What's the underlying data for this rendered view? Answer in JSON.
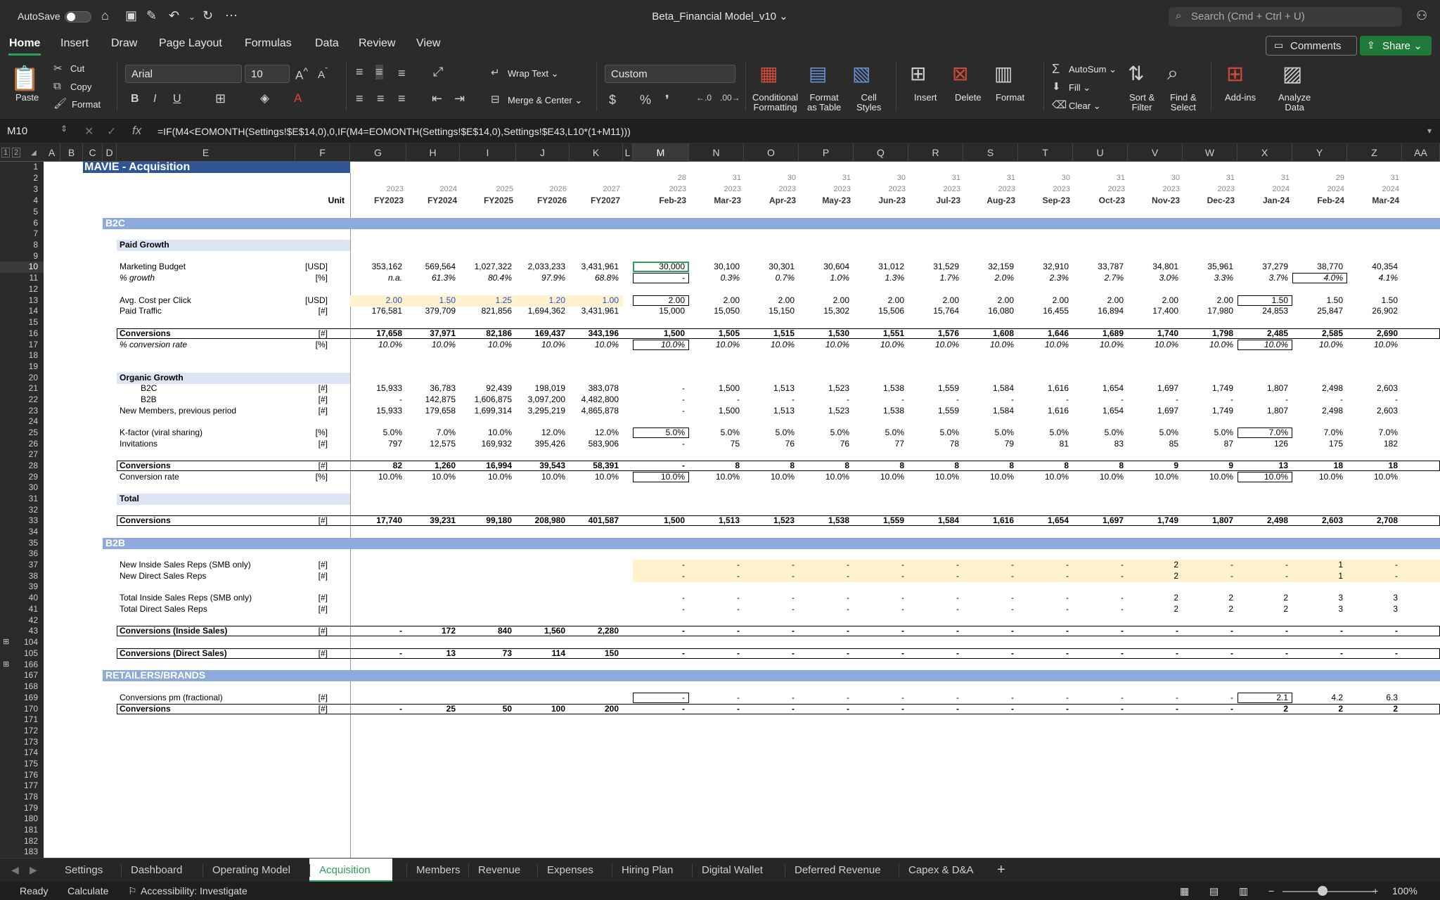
{
  "app": {
    "autosave_label": "AutoSave",
    "doc_title": "Beta_Financial Model_v10",
    "search_placeholder": "Search (Cmd + Ctrl + U)"
  },
  "ribbon_tabs": [
    "Home",
    "Insert",
    "Draw",
    "Page Layout",
    "Formulas",
    "Data",
    "Review",
    "View"
  ],
  "ribbon_buttons": {
    "comments": "Comments",
    "share": "Share",
    "paste": "Paste",
    "cut": "Cut",
    "copy": "Copy",
    "format_painter": "Format",
    "font_name": "Arial",
    "font_size": "10",
    "wrap_text": "Wrap Text",
    "merge_center": "Merge & Center",
    "number_format": "Custom",
    "conditional_formatting": "Conditional\nFormatting",
    "format_as_table": "Format\nas Table",
    "cell_styles": "Cell\nStyles",
    "insert": "Insert",
    "delete": "Delete",
    "format": "Format",
    "autosum": "AutoSum",
    "fill": "Fill",
    "clear": "Clear",
    "sort_filter": "Sort &\nFilter",
    "find_select": "Find &\nSelect",
    "add_ins": "Add-ins",
    "analyze_data": "Analyze\nData"
  },
  "formula_bar": {
    "cell_ref": "M10",
    "fx": "fx",
    "formula": "=IF(M4<EOMONTH(Settings!$E$14,0),0,IF(M4=EOMONTH(Settings!$E$14,0),Settings!$E43,L10*(1+M11)))"
  },
  "columns": [
    "A",
    "B",
    "C",
    "D",
    "E",
    "F",
    "G",
    "H",
    "I",
    "J",
    "K",
    "L",
    "M",
    "N",
    "O",
    "P",
    "Q",
    "R",
    "S",
    "T",
    "U",
    "V",
    "W",
    "X",
    "Y",
    "Z",
    "AA"
  ],
  "row_numbers": [
    "1",
    "2",
    "3",
    "4",
    "5",
    "6",
    "7",
    "8",
    "9",
    "10",
    "11",
    "12",
    "13",
    "14",
    "15",
    "16",
    "17",
    "18",
    "19",
    "20",
    "21",
    "22",
    "23",
    "24",
    "25",
    "26",
    "27",
    "28",
    "29",
    "30",
    "31",
    "32",
    "33",
    "34",
    "35",
    "36",
    "37",
    "38",
    "39",
    "40",
    "41",
    "42",
    "43",
    "104",
    "105",
    "166",
    "167",
    "168",
    "169",
    "170",
    "171",
    "172",
    "173",
    "174",
    "175",
    "176",
    "177",
    "178",
    "179",
    "180",
    "181",
    "182",
    "183"
  ],
  "sheet": {
    "title": "MAVIE - Acquisition",
    "unit_header": "Unit",
    "header_row2": [
      "",
      "",
      "",
      "",
      "",
      "28",
      "31",
      "30",
      "31",
      "30",
      "31",
      "31",
      "30",
      "31",
      "30",
      "31",
      "31",
      "29",
      "31"
    ],
    "header_row3": [
      "2023",
      "2024",
      "2025",
      "2026",
      "2027",
      "2023",
      "2023",
      "2023",
      "2023",
      "2023",
      "2023",
      "2023",
      "2023",
      "2023",
      "2023",
      "2023",
      "2024",
      "2024",
      "2024"
    ],
    "header_row4": [
      "FY2023",
      "FY2024",
      "FY2025",
      "FY2026",
      "FY2027",
      "Feb-23",
      "Mar-23",
      "Apr-23",
      "May-23",
      "Jun-23",
      "Jul-23",
      "Aug-23",
      "Sep-23",
      "Oct-23",
      "Nov-23",
      "Dec-23",
      "Jan-24",
      "Feb-24",
      "Mar-24"
    ],
    "sections": {
      "b2c": "B2C",
      "paid_growth": "Paid Growth",
      "organic_growth": "Organic Growth",
      "total": "Total",
      "b2b": "B2B",
      "retailers": "RETAILERS/BRANDS"
    },
    "rows": [
      {
        "label": "Marketing Budget",
        "unit": "[USD]",
        "vals": [
          "353,162",
          "569,564",
          "1,027,322",
          "2,033,233",
          "3,431,961",
          "30,000",
          "30,100",
          "30,301",
          "30,604",
          "31,012",
          "31,529",
          "32,159",
          "32,910",
          "33,787",
          "34,801",
          "35,961",
          "37,279",
          "38,770",
          "40,354"
        ]
      },
      {
        "label": "% growth",
        "unit": "[%]",
        "vals": [
          "n.a.",
          "61.3%",
          "80.4%",
          "97.9%",
          "68.8%",
          "-",
          "0.3%",
          "0.7%",
          "1.0%",
          "1.3%",
          "1.7%",
          "2.0%",
          "2.3%",
          "2.7%",
          "3.0%",
          "3.3%",
          "3.7%",
          "4.0%",
          "4.1%"
        ]
      },
      {
        "label": "Avg. Cost per Click",
        "unit": "[USD]",
        "vals": [
          "2.00",
          "1.50",
          "1.25",
          "1.20",
          "1.00",
          "2.00",
          "2.00",
          "2.00",
          "2.00",
          "2.00",
          "2.00",
          "2.00",
          "2.00",
          "2.00",
          "2.00",
          "2.00",
          "1.50",
          "1.50",
          "1.50"
        ]
      },
      {
        "label": "Paid Traffic",
        "unit": "[#]",
        "vals": [
          "176,581",
          "379,709",
          "821,856",
          "1,694,362",
          "3,431,961",
          "15,000",
          "15,050",
          "15,150",
          "15,302",
          "15,506",
          "15,764",
          "16,080",
          "16,455",
          "16,894",
          "17,400",
          "17,980",
          "24,853",
          "25,847",
          "26,902"
        ]
      },
      {
        "label": "Conversions",
        "unit": "[#]",
        "vals": [
          "17,658",
          "37,971",
          "82,186",
          "169,437",
          "343,196",
          "1,500",
          "1,505",
          "1,515",
          "1,530",
          "1,551",
          "1,576",
          "1,608",
          "1,646",
          "1,689",
          "1,740",
          "1,798",
          "2,485",
          "2,585",
          "2,690"
        ]
      },
      {
        "label": "% conversion rate",
        "unit": "[%]",
        "vals": [
          "10.0%",
          "10.0%",
          "10.0%",
          "10.0%",
          "10.0%",
          "10.0%",
          "10.0%",
          "10.0%",
          "10.0%",
          "10.0%",
          "10.0%",
          "10.0%",
          "10.0%",
          "10.0%",
          "10.0%",
          "10.0%",
          "10.0%",
          "10.0%",
          "10.0%"
        ]
      },
      {
        "label": "B2C",
        "unit": "[#]",
        "vals": [
          "15,933",
          "36,783",
          "92,439",
          "198,019",
          "383,078",
          "-",
          "1,500",
          "1,513",
          "1,523",
          "1,538",
          "1,559",
          "1,584",
          "1,616",
          "1,654",
          "1,697",
          "1,749",
          "1,807",
          "2,498",
          "2,603"
        ]
      },
      {
        "label": "B2B",
        "unit": "[#]",
        "vals": [
          "-",
          "142,875",
          "1,606,875",
          "3,097,200",
          "4,482,800",
          "-",
          "-",
          "-",
          "-",
          "-",
          "-",
          "-",
          "-",
          "-",
          "-",
          "-",
          "-",
          "-",
          "-"
        ]
      },
      {
        "label": "New Members, previous period",
        "unit": "[#]",
        "vals": [
          "15,933",
          "179,658",
          "1,699,314",
          "3,295,219",
          "4,865,878",
          "-",
          "1,500",
          "1,513",
          "1,523",
          "1,538",
          "1,559",
          "1,584",
          "1,616",
          "1,654",
          "1,697",
          "1,749",
          "1,807",
          "2,498",
          "2,603"
        ]
      },
      {
        "label": "K-factor (viral sharing)",
        "unit": "[%]",
        "vals": [
          "5.0%",
          "7.0%",
          "10.0%",
          "12.0%",
          "12.0%",
          "5.0%",
          "5.0%",
          "5.0%",
          "5.0%",
          "5.0%",
          "5.0%",
          "5.0%",
          "5.0%",
          "5.0%",
          "5.0%",
          "5.0%",
          "7.0%",
          "7.0%",
          "7.0%"
        ]
      },
      {
        "label": "Invitations",
        "unit": "[#]",
        "vals": [
          "797",
          "12,575",
          "169,932",
          "395,426",
          "583,906",
          "-",
          "75",
          "76",
          "76",
          "77",
          "78",
          "79",
          "81",
          "83",
          "85",
          "87",
          "126",
          "175",
          "182"
        ]
      },
      {
        "label": "Conversions",
        "unit": "[#]",
        "vals": [
          "82",
          "1,260",
          "16,994",
          "39,543",
          "58,391",
          "-",
          "8",
          "8",
          "8",
          "8",
          "8",
          "8",
          "8",
          "8",
          "9",
          "9",
          "13",
          "18",
          "18"
        ]
      },
      {
        "label": "Conversion rate",
        "unit": "[%]",
        "vals": [
          "10.0%",
          "10.0%",
          "10.0%",
          "10.0%",
          "10.0%",
          "10.0%",
          "10.0%",
          "10.0%",
          "10.0%",
          "10.0%",
          "10.0%",
          "10.0%",
          "10.0%",
          "10.0%",
          "10.0%",
          "10.0%",
          "10.0%",
          "10.0%",
          "10.0%"
        ]
      },
      {
        "label": "Conversions",
        "unit": "[#]",
        "vals": [
          "17,740",
          "39,231",
          "99,180",
          "208,980",
          "401,587",
          "1,500",
          "1,513",
          "1,523",
          "1,538",
          "1,559",
          "1,584",
          "1,616",
          "1,654",
          "1,697",
          "1,749",
          "1,807",
          "2,498",
          "2,603",
          "2,708"
        ]
      },
      {
        "label": "New Inside Sales Reps (SMB only)",
        "unit": "[#]",
        "vals": [
          "",
          "",
          "",
          "",
          "",
          "-",
          "-",
          "-",
          "-",
          "-",
          "-",
          "-",
          "-",
          "-",
          "2",
          "-",
          "-",
          "1",
          "-"
        ]
      },
      {
        "label": "New Direct Sales Reps",
        "unit": "[#]",
        "vals": [
          "",
          "",
          "",
          "",
          "",
          "-",
          "-",
          "-",
          "-",
          "-",
          "-",
          "-",
          "-",
          "-",
          "2",
          "-",
          "-",
          "1",
          "-"
        ]
      },
      {
        "label": "Total Inside Sales Reps (SMB only)",
        "unit": "[#]",
        "vals": [
          "",
          "",
          "",
          "",
          "",
          "-",
          "-",
          "-",
          "-",
          "-",
          "-",
          "-",
          "-",
          "-",
          "2",
          "2",
          "2",
          "3",
          "3"
        ]
      },
      {
        "label": "Total Direct Sales Reps",
        "unit": "[#]",
        "vals": [
          "",
          "",
          "",
          "",
          "",
          "-",
          "-",
          "-",
          "-",
          "-",
          "-",
          "-",
          "-",
          "-",
          "2",
          "2",
          "2",
          "3",
          "3"
        ]
      },
      {
        "label": "Conversions (Inside Sales)",
        "unit": "[#]",
        "vals": [
          "-",
          "172",
          "840",
          "1,560",
          "2,280",
          "-",
          "-",
          "-",
          "-",
          "-",
          "-",
          "-",
          "-",
          "-",
          "-",
          "-",
          "-",
          "-",
          "-"
        ]
      },
      {
        "label": "Conversions (Direct Sales)",
        "unit": "[#]",
        "vals": [
          "-",
          "13",
          "73",
          "114",
          "150",
          "-",
          "-",
          "-",
          "-",
          "-",
          "-",
          "-",
          "-",
          "-",
          "-",
          "-",
          "-",
          "-",
          "-"
        ]
      },
      {
        "label": "Conversions pm (fractional)",
        "unit": "[#]",
        "vals": [
          "",
          "",
          "",
          "",
          "",
          "-",
          "-",
          "-",
          "-",
          "-",
          "-",
          "-",
          "-",
          "-",
          "-",
          "-",
          "2.1",
          "4.2",
          "6.3"
        ]
      },
      {
        "label": "Conversions",
        "unit": "[#]",
        "vals": [
          "-",
          "25",
          "50",
          "100",
          "200",
          "-",
          "-",
          "-",
          "-",
          "-",
          "-",
          "-",
          "-",
          "-",
          "-",
          "-",
          "2",
          "2",
          "2"
        ]
      }
    ]
  },
  "sheet_tabs": [
    "Settings",
    "Dashboard",
    "Operating Model",
    "Acquisition",
    "Members",
    "Revenue",
    "Expenses",
    "Hiring Plan",
    "Digital Wallet",
    "Deferred Revenue",
    "Capex & D&A"
  ],
  "status": {
    "ready": "Ready",
    "calculate": "Calculate",
    "accessibility": "Accessibility: Investigate",
    "zoom": "100%"
  },
  "colors": {
    "section_band": "#8ea9db",
    "title_band": "#2f5597",
    "subsection_band": "#dde4f3",
    "input_yellow": "#fff2cc",
    "accent_green": "#2f9e5a"
  }
}
